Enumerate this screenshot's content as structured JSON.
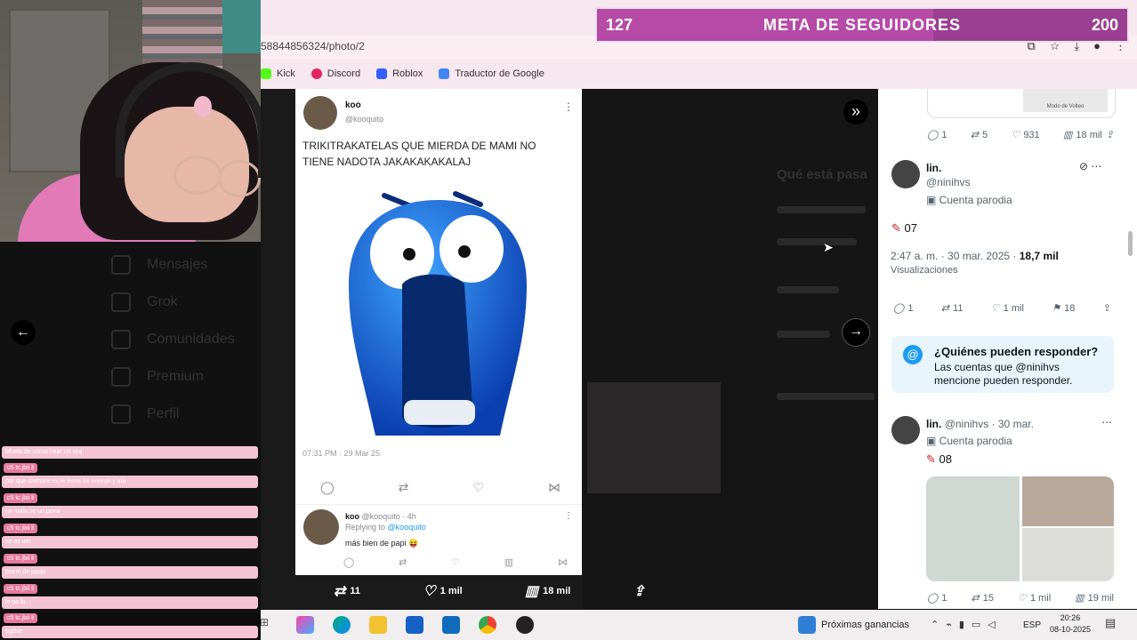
{
  "browser": {
    "url": "58844856324/photo/2",
    "bookmarks": [
      "Kick",
      "Discord",
      "Roblox",
      "Traductor de Google"
    ]
  },
  "meta_banner": {
    "title": "META DE SEGUIDORES",
    "current": "127",
    "goal": "200",
    "progress_fraction": 0.635
  },
  "chat": {
    "rows": [
      {
        "name": "",
        "text": "bfuelo de como hear un ujuj"
      },
      {
        "name": "c5 tc.jbii li",
        "text": "por que siempre es le tema de unerga y ahi"
      },
      {
        "name": "c5 tc.jbii li",
        "text": "un mala se un pena"
      },
      {
        "name": "c5 tc.jbii li",
        "text": "se es uhl"
      },
      {
        "name": "c5 tc.jbii li",
        "text": "poem de jajaja"
      },
      {
        "name": "c5 tc.jbii li",
        "text": "le pa la"
      },
      {
        "name": "c5 tc.jbii li",
        "text": "tsjdsle"
      }
    ]
  },
  "left_nav_dim": [
    "Mensajes",
    "Grok",
    "Comunidades",
    "Premium",
    "Perfil"
  ],
  "tweet": {
    "name": "koo",
    "handle": "@kooquito",
    "text": "TRIKITRAKATELAS QUE MIERDA DE MAMI NO TIENE NADOTA JAKAKAKAKALAJ",
    "time": "07:31 PM · 29 Mar 25"
  },
  "reply": {
    "name": "koo",
    "meta": "@kooquito · 4h",
    "replying": "Replying to",
    "replying_handle": "@kooquito",
    "text": "más bien de papi 😝"
  },
  "photo_stats": {
    "retweets": "11",
    "likes": "1 mil",
    "views": "18 mil"
  },
  "side": {
    "top_stats": {
      "replies": "1",
      "retweets": "5",
      "likes": "931",
      "views": "18 mil"
    },
    "prev_img_label": "Modo de Volteo",
    "post1": {
      "name": "lin.",
      "handle": "@ninihvs",
      "label": "Cuenta parodia",
      "text": "07",
      "time": "2:47 a. m. · 30 mar. 2025 ·",
      "views_count": "18,7 mil",
      "views_label": "Visualizaciones",
      "stats": {
        "replies": "1",
        "retweets": "11",
        "likes": "1 mil",
        "bookmarks": "18"
      }
    },
    "who_reply": {
      "title": "¿Quiénes pueden responder?",
      "desc": "Las cuentas que @ninihvs mencione pueden responder."
    },
    "post2": {
      "name": "lin.",
      "meta": "@ninihvs · 30 mar.",
      "label": "Cuenta parodia",
      "text": "08",
      "stats": {
        "replies": "1",
        "retweets": "15",
        "likes": "1 mil",
        "views": "19 mil"
      }
    },
    "dim_heading": "Qué está pasa"
  },
  "taskbar": {
    "widget_label": "Próximas ganancias",
    "lang": "ESP",
    "time": "20:26",
    "date": "08-10-2025"
  },
  "colors": {
    "accent": "#1d9bf0",
    "meta_bar": "#9b3f92",
    "chat_bg": "#f4c4d4"
  }
}
